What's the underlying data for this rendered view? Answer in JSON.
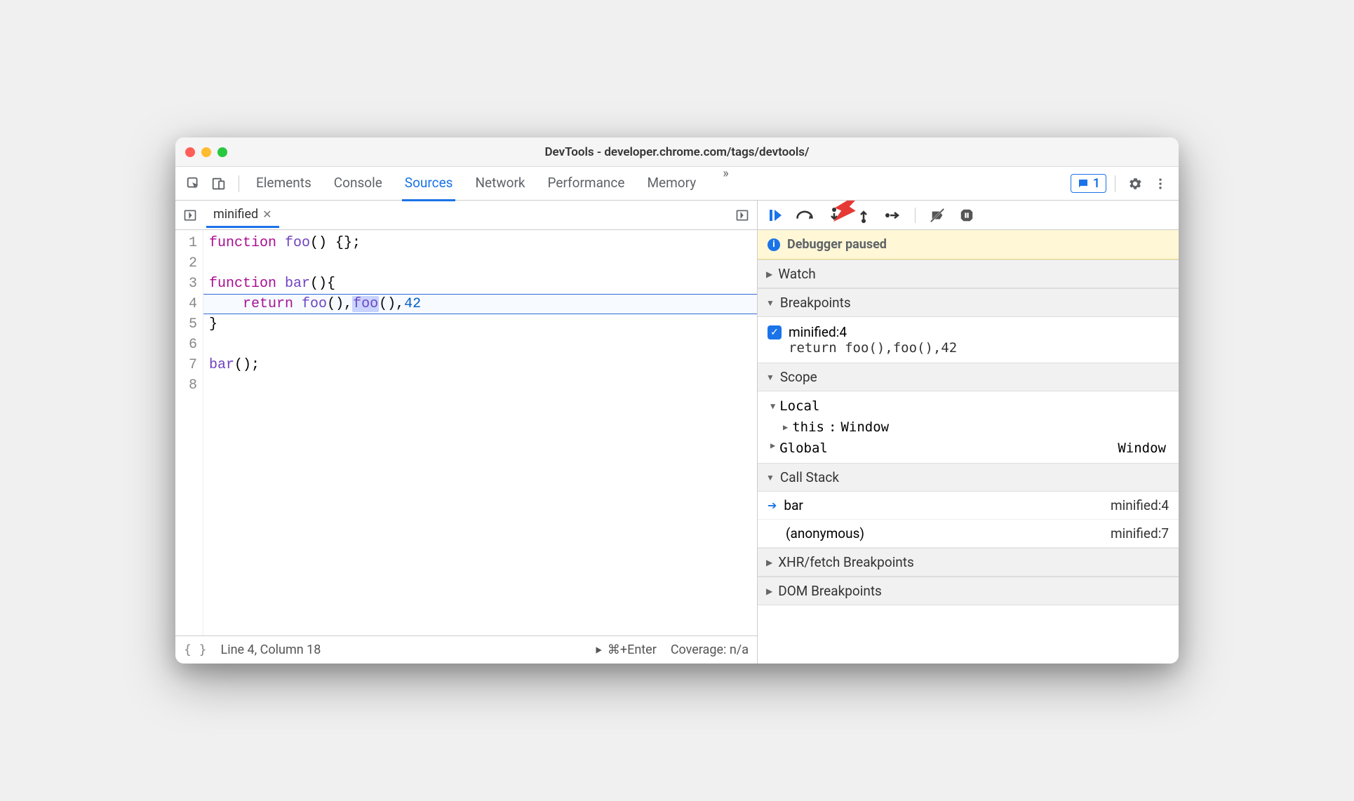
{
  "window": {
    "title": "DevTools - developer.chrome.com/tags/devtools/"
  },
  "toolbar": {
    "tabs": [
      "Elements",
      "Console",
      "Sources",
      "Network",
      "Performance",
      "Memory"
    ],
    "active_tab": "Sources",
    "chat_count": "1"
  },
  "file_tab": {
    "name": "minified"
  },
  "editor": {
    "line_count": 8,
    "highlight_line": 4,
    "lines_raw": [
      "function foo() {};",
      "",
      "function bar(){",
      "    return foo(),foo(),42",
      "}",
      "",
      "bar();",
      ""
    ]
  },
  "statusbar": {
    "pos": "Line 4, Column 18",
    "run_hint": "⌘+Enter",
    "coverage": "Coverage: n/a"
  },
  "debugger": {
    "paused_text": "Debugger paused",
    "sections": {
      "watch": "Watch",
      "breakpoints": "Breakpoints",
      "scope": "Scope",
      "callstack": "Call Stack",
      "xhr": "XHR/fetch Breakpoints",
      "dom": "DOM Breakpoints"
    },
    "breakpoints": [
      {
        "label": "minified:4",
        "code": "return foo(),foo(),42"
      }
    ],
    "scope": {
      "local_label": "Local",
      "this_label": "this",
      "this_value": "Window",
      "global_label": "Global",
      "global_value": "Window"
    },
    "callstack": [
      {
        "name": "bar",
        "loc": "minified:4",
        "current": true
      },
      {
        "name": "(anonymous)",
        "loc": "minified:7",
        "current": false
      }
    ]
  }
}
